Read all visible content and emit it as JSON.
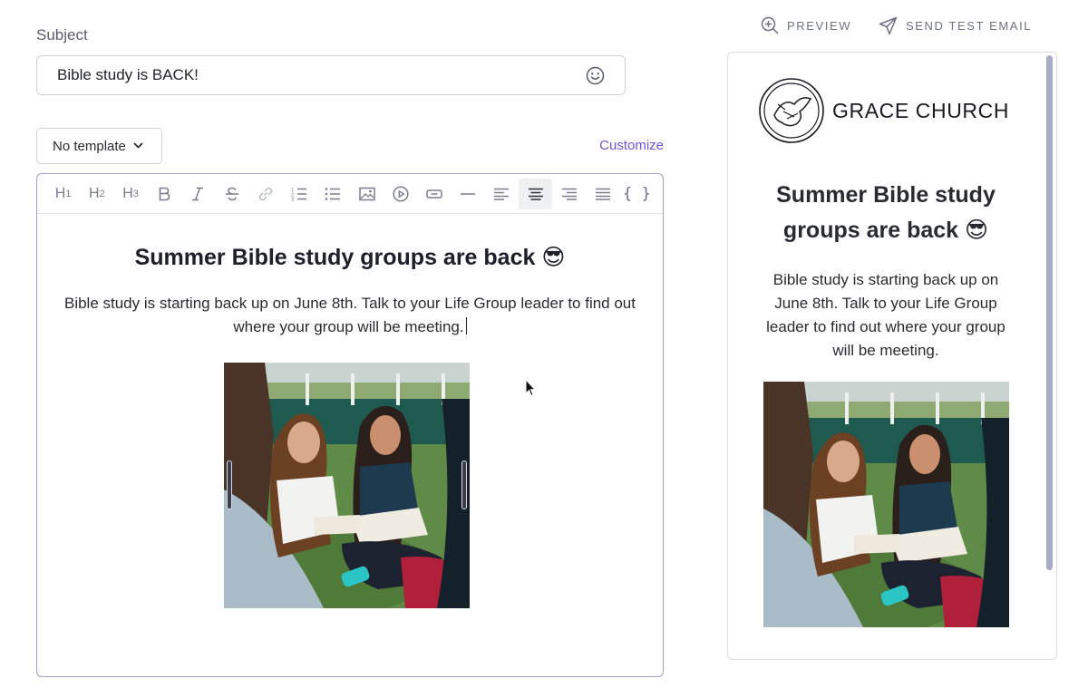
{
  "subject": {
    "label": "Subject",
    "value": "Bible study is BACK!",
    "emoji_icon": "smiley-icon"
  },
  "template": {
    "selected": "No template",
    "customize_label": "Customize"
  },
  "toolbar": {
    "items": [
      "H1",
      "H2",
      "H3",
      "bold",
      "italic",
      "strikethrough",
      "link",
      "ordered-list",
      "bullet-list",
      "image",
      "video",
      "button",
      "divider",
      "align-left",
      "align-center",
      "align-right",
      "justify",
      "merge-tags"
    ],
    "active": "align-center"
  },
  "editor": {
    "title": "Summer Bible study groups are back 😎",
    "paragraph": "Bible study is starting back up on June 8th. Talk to your Life Group leader to find out where your group will be meeting."
  },
  "actions": {
    "preview": "PREVIEW",
    "send_test": "SEND TEST EMAIL"
  },
  "preview": {
    "brand_name": "GRACE CHURCH",
    "title": "Summer Bible study groups are back 😎",
    "paragraph": "Bible study is starting back up on June 8th. Talk to your Life Group leader to find out where your group will be meeting."
  },
  "colors": {
    "accent": "#6f55d9",
    "editor_border": "#9fa3c2",
    "scrollbar": "#a8acc6"
  }
}
